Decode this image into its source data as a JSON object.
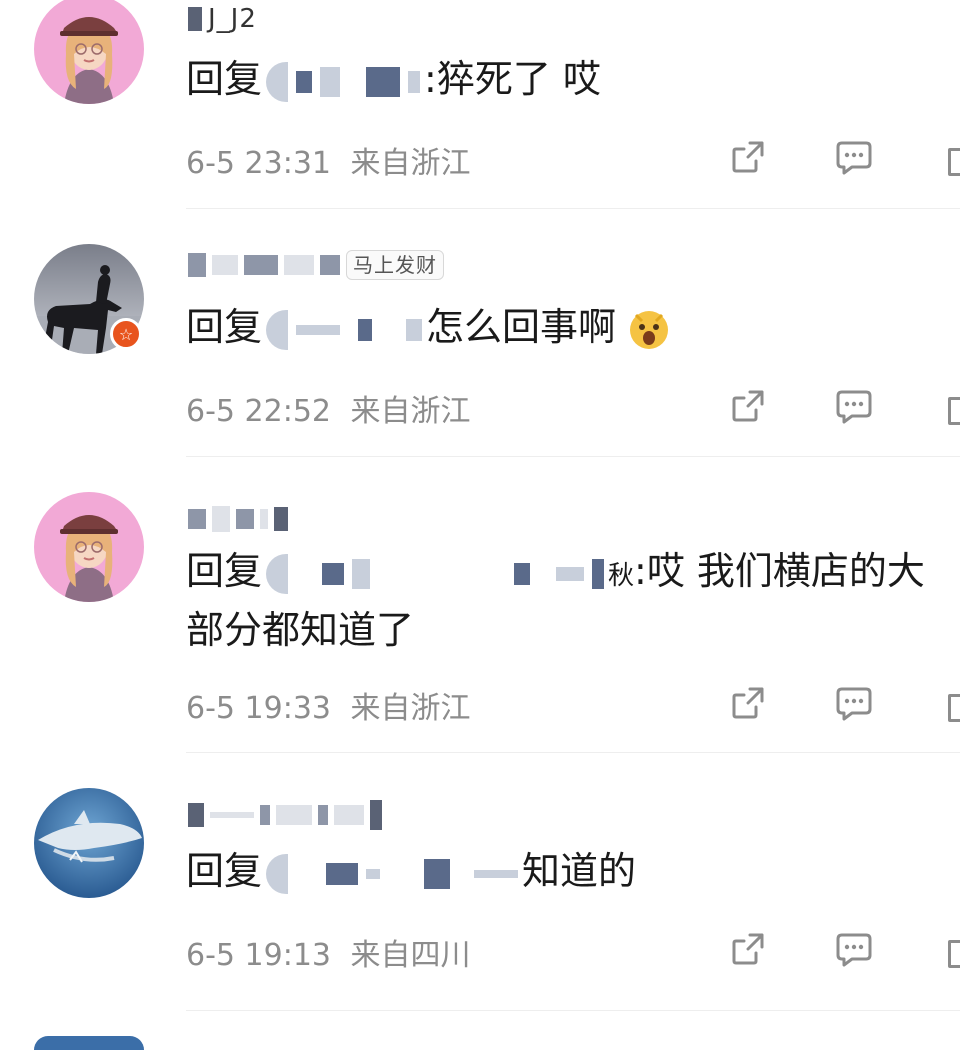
{
  "comments": [
    {
      "username_fragment": "J_J2",
      "reply_prefix": "回复",
      "reply_suffix": ":猝死了 哎",
      "time": "6-5 23:31",
      "location": "来自浙江",
      "avatar": "girl-with-cap"
    },
    {
      "username_tag": "马上发财",
      "reply_prefix": "回复",
      "reply_suffix": "怎么回事啊",
      "emoji": "surprised-face-emoji",
      "time": "6-5 22:52",
      "location": "来自浙江",
      "avatar": "horse-rider-silhouette"
    },
    {
      "reply_prefix": "回复",
      "reply_mid": "秋",
      "reply_suffix": ":哎 我们横店的大",
      "reply_line2": "部分都知道了",
      "time": "6-5 19:33",
      "location": "来自浙江",
      "avatar": "girl-with-cap"
    },
    {
      "reply_prefix": "回复",
      "reply_suffix": "知道的",
      "time": "6-5 19:13",
      "location": "来自四川",
      "avatar": "shark"
    }
  ],
  "colors": {
    "meta_text": "#8c8c8c",
    "body_text": "#1a1a1a",
    "badge": "#e8541e"
  }
}
